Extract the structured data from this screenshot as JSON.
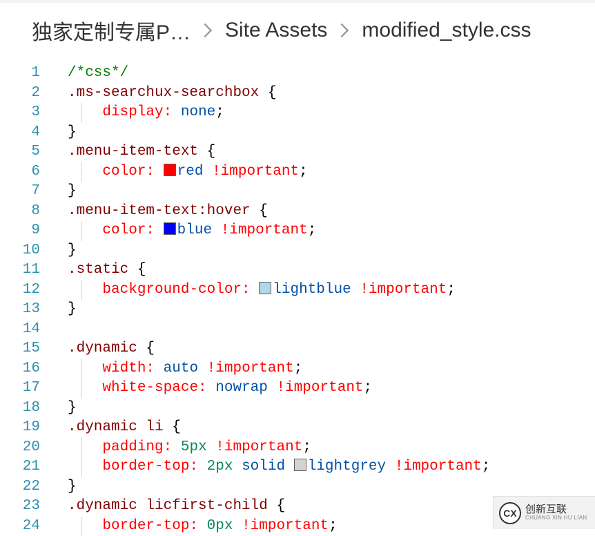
{
  "breadcrumb": {
    "items": [
      {
        "label": "独家定制专属P…"
      },
      {
        "label": "Site Assets"
      },
      {
        "label": "modified_style.css"
      }
    ]
  },
  "editor": {
    "line_start": 1,
    "line_end": 24,
    "tokens": [
      [
        {
          "t": "/*css*/",
          "c": "c-comment"
        }
      ],
      [
        {
          "t": ".ms-searchux-searchbox",
          "c": "c-sel"
        },
        {
          "t": " {",
          "c": "c-punct"
        }
      ],
      [
        {
          "t": "    ",
          "c": ""
        },
        {
          "t": "display:",
          "c": "c-prop"
        },
        {
          "t": " ",
          "c": ""
        },
        {
          "t": "none",
          "c": "c-valkw"
        },
        {
          "t": ";",
          "c": "c-punct"
        }
      ],
      [
        {
          "t": "}",
          "c": "c-punct"
        }
      ],
      [
        {
          "t": ".menu-item-text",
          "c": "c-sel"
        },
        {
          "t": " {",
          "c": "c-punct"
        }
      ],
      [
        {
          "t": "    ",
          "c": ""
        },
        {
          "t": "color:",
          "c": "c-prop"
        },
        {
          "t": " ",
          "c": ""
        },
        {
          "swatch": "#ff0000"
        },
        {
          "t": "red",
          "c": "c-valkw"
        },
        {
          "t": " ",
          "c": ""
        },
        {
          "t": "!important",
          "c": "c-imp"
        },
        {
          "t": ";",
          "c": "c-punct"
        }
      ],
      [
        {
          "t": "}",
          "c": "c-punct"
        }
      ],
      [
        {
          "t": ".menu-item-text:hover",
          "c": "c-sel"
        },
        {
          "t": " {",
          "c": "c-punct"
        }
      ],
      [
        {
          "t": "    ",
          "c": ""
        },
        {
          "t": "color:",
          "c": "c-prop"
        },
        {
          "t": " ",
          "c": ""
        },
        {
          "swatch": "#0000ff"
        },
        {
          "t": "blue",
          "c": "c-valkw"
        },
        {
          "t": " ",
          "c": ""
        },
        {
          "t": "!important",
          "c": "c-imp"
        },
        {
          "t": ";",
          "c": "c-punct"
        }
      ],
      [
        {
          "t": "}",
          "c": "c-punct"
        }
      ],
      [
        {
          "t": ".static",
          "c": "c-sel"
        },
        {
          "t": " {",
          "c": "c-punct"
        }
      ],
      [
        {
          "t": "    ",
          "c": ""
        },
        {
          "t": "background-color:",
          "c": "c-prop"
        },
        {
          "t": " ",
          "c": ""
        },
        {
          "swatch": "#add8e6"
        },
        {
          "t": "lightblue",
          "c": "c-valkw"
        },
        {
          "t": " ",
          "c": ""
        },
        {
          "t": "!important",
          "c": "c-imp"
        },
        {
          "t": ";",
          "c": "c-punct"
        }
      ],
      [
        {
          "t": "}",
          "c": "c-punct"
        }
      ],
      [],
      [
        {
          "t": ".dynamic",
          "c": "c-sel"
        },
        {
          "t": " {",
          "c": "c-punct"
        }
      ],
      [
        {
          "t": "    ",
          "c": ""
        },
        {
          "t": "width:",
          "c": "c-prop"
        },
        {
          "t": " ",
          "c": ""
        },
        {
          "t": "auto",
          "c": "c-valkw"
        },
        {
          "t": " ",
          "c": ""
        },
        {
          "t": "!important",
          "c": "c-imp"
        },
        {
          "t": ";",
          "c": "c-punct"
        }
      ],
      [
        {
          "t": "    ",
          "c": ""
        },
        {
          "t": "white-space:",
          "c": "c-prop"
        },
        {
          "t": " ",
          "c": ""
        },
        {
          "t": "nowrap",
          "c": "c-valkw"
        },
        {
          "t": " ",
          "c": ""
        },
        {
          "t": "!important",
          "c": "c-imp"
        },
        {
          "t": ";",
          "c": "c-punct"
        }
      ],
      [
        {
          "t": "}",
          "c": "c-punct"
        }
      ],
      [
        {
          "t": ".dynamic li",
          "c": "c-sel"
        },
        {
          "t": " {",
          "c": "c-punct"
        }
      ],
      [
        {
          "t": "    ",
          "c": ""
        },
        {
          "t": "padding:",
          "c": "c-prop"
        },
        {
          "t": " ",
          "c": ""
        },
        {
          "t": "5px",
          "c": "c-num"
        },
        {
          "t": " ",
          "c": ""
        },
        {
          "t": "!important",
          "c": "c-imp"
        },
        {
          "t": ";",
          "c": "c-punct"
        }
      ],
      [
        {
          "t": "    ",
          "c": ""
        },
        {
          "t": "border-top:",
          "c": "c-prop"
        },
        {
          "t": " ",
          "c": ""
        },
        {
          "t": "2px",
          "c": "c-num"
        },
        {
          "t": " ",
          "c": ""
        },
        {
          "t": "solid",
          "c": "c-valkw"
        },
        {
          "t": " ",
          "c": ""
        },
        {
          "swatch": "#d3d3d3"
        },
        {
          "t": "lightgrey",
          "c": "c-valkw"
        },
        {
          "t": " ",
          "c": ""
        },
        {
          "t": "!important",
          "c": "c-imp"
        },
        {
          "t": ";",
          "c": "c-punct"
        }
      ],
      [
        {
          "t": "}",
          "c": "c-punct"
        }
      ],
      [
        {
          "t": ".dynamic licfirst-child",
          "c": "c-sel"
        },
        {
          "t": " {",
          "c": "c-punct"
        }
      ],
      [
        {
          "t": "    ",
          "c": ""
        },
        {
          "t": "border-top:",
          "c": "c-prop"
        },
        {
          "t": " ",
          "c": ""
        },
        {
          "t": "0px",
          "c": "c-num"
        },
        {
          "t": " ",
          "c": ""
        },
        {
          "t": "!important",
          "c": "c-imp"
        },
        {
          "t": ";",
          "c": "c-punct"
        }
      ]
    ],
    "has_indent_guide": [
      false,
      false,
      true,
      false,
      false,
      true,
      false,
      false,
      true,
      false,
      false,
      true,
      false,
      false,
      false,
      true,
      true,
      false,
      false,
      true,
      true,
      false,
      false,
      true
    ]
  },
  "watermark": {
    "logo_text": "CX",
    "cn": "创新互联",
    "en": "CHUANG XIN HU LIAN"
  }
}
